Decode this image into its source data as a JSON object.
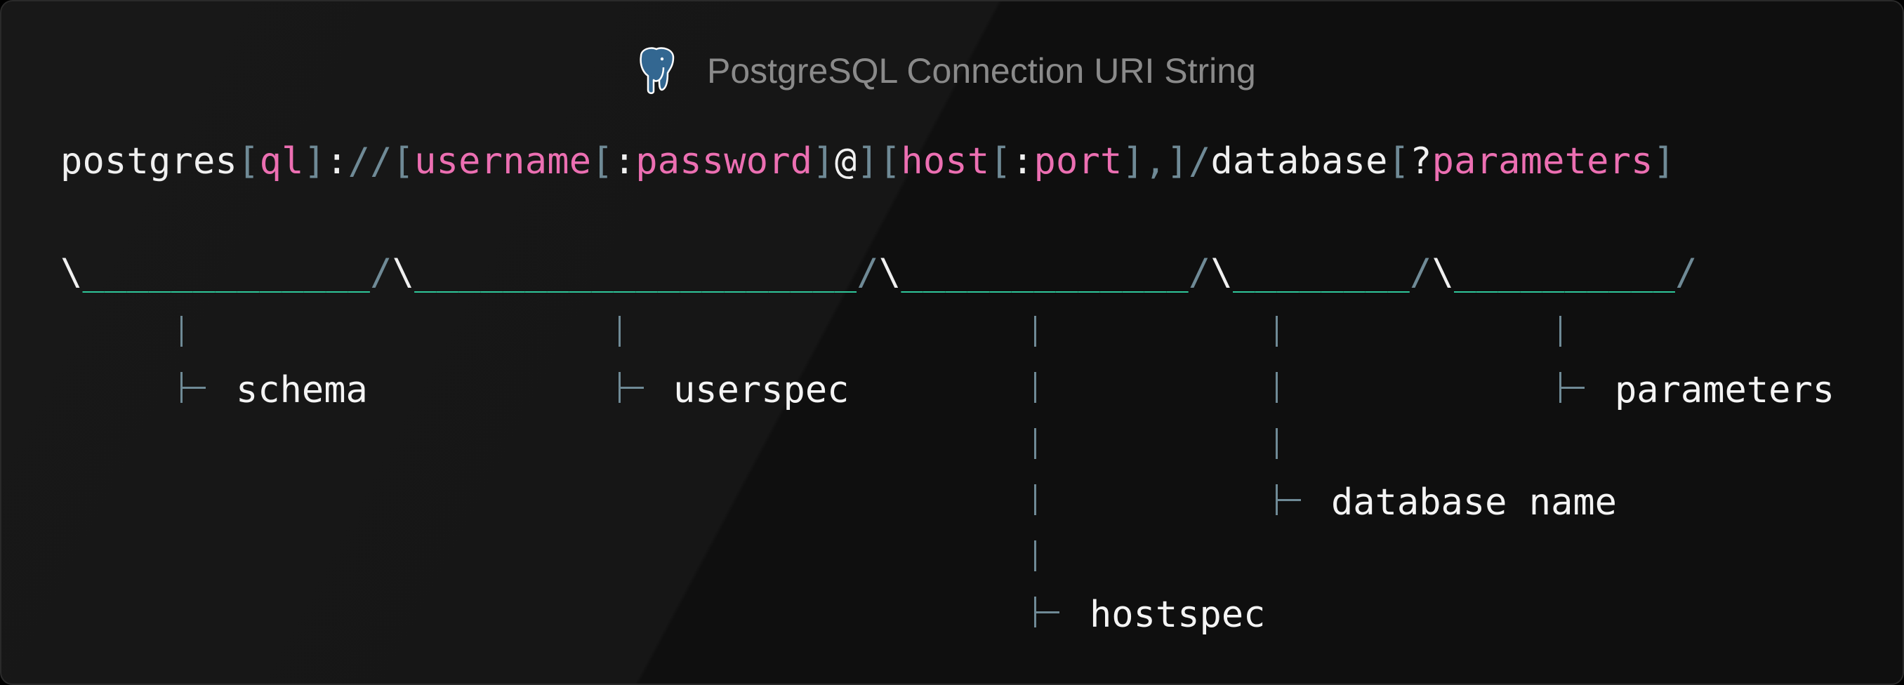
{
  "header": {
    "title": "PostgreSQL Connection URI String",
    "logo_icon": "postgresql-elephant-icon"
  },
  "uri": [
    {
      "text": "postgres",
      "style": "white"
    },
    {
      "text": "[",
      "style": "gray"
    },
    {
      "text": "ql",
      "style": "pink"
    },
    {
      "text": "]",
      "style": "gray"
    },
    {
      "text": ":",
      "style": "white"
    },
    {
      "text": "//",
      "style": "gray"
    },
    {
      "text": "[",
      "style": "gray"
    },
    {
      "text": "username",
      "style": "pink"
    },
    {
      "text": "[",
      "style": "gray"
    },
    {
      "text": ":",
      "style": "white"
    },
    {
      "text": "password",
      "style": "pink"
    },
    {
      "text": "]",
      "style": "gray"
    },
    {
      "text": "@",
      "style": "white"
    },
    {
      "text": "]",
      "style": "gray"
    },
    {
      "text": "[",
      "style": "gray"
    },
    {
      "text": "host",
      "style": "pink"
    },
    {
      "text": "[",
      "style": "gray"
    },
    {
      "text": ":",
      "style": "white"
    },
    {
      "text": "port",
      "style": "pink"
    },
    {
      "text": "]",
      "style": "gray"
    },
    {
      "text": ",",
      "style": "gray"
    },
    {
      "text": "]",
      "style": "gray"
    },
    {
      "text": "/",
      "style": "gray"
    },
    {
      "text": "database",
      "style": "white"
    },
    {
      "text": "[",
      "style": "gray"
    },
    {
      "text": "?",
      "style": "white"
    },
    {
      "text": "parameters",
      "style": "pink"
    },
    {
      "text": "]",
      "style": "gray"
    }
  ],
  "braces": [
    {
      "text": "\\",
      "style": "white"
    },
    {
      "text": "_____________",
      "style": "teal"
    },
    {
      "text": "/",
      "style": "gray"
    },
    {
      "text": "\\",
      "style": "white"
    },
    {
      "text": "____________________",
      "style": "teal"
    },
    {
      "text": "/",
      "style": "gray"
    },
    {
      "text": "\\",
      "style": "white"
    },
    {
      "text": "_____________",
      "style": "teal"
    },
    {
      "text": "/",
      "style": "gray"
    },
    {
      "text": "\\",
      "style": "white"
    },
    {
      "text": "________",
      "style": "teal"
    },
    {
      "text": "/",
      "style": "gray"
    },
    {
      "text": "\\",
      "style": "white"
    },
    {
      "text": "__________",
      "style": "teal"
    },
    {
      "text": "/",
      "style": "gray"
    }
  ],
  "labels": {
    "schema": "schema",
    "userspec": "userspec",
    "hostspec": "hostspec",
    "database_name": "database name",
    "parameters": "parameters"
  },
  "colors": {
    "background": "#111111",
    "white": "#f0f0f0",
    "pink": "#ec6fb2",
    "gray": "#6f8a96",
    "teal": "#2fc79a",
    "title": "#8a8a8a"
  }
}
